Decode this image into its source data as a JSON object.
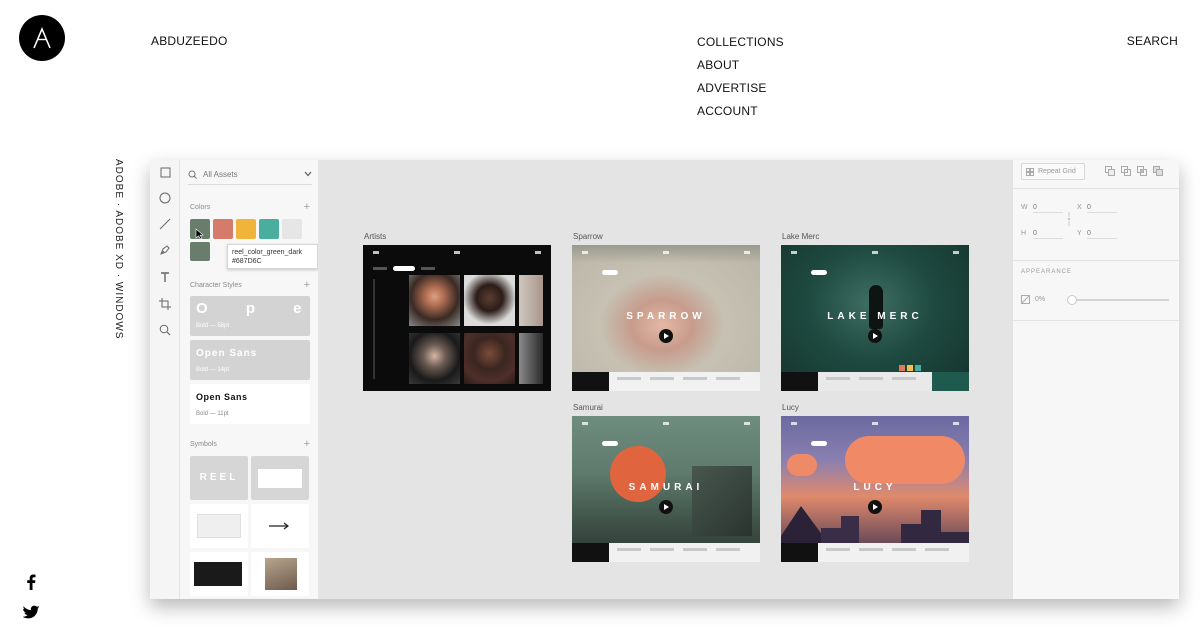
{
  "site": {
    "brand": "ABDUZEEDO",
    "nav": [
      "COLLECTIONS",
      "ABOUT",
      "ADVERTISE",
      "ACCOUNT"
    ],
    "search_label": "SEARCH",
    "vertical_label": "ADOBE · ADOBE XD · WINDOWS",
    "social": [
      "facebook-icon",
      "twitter-icon"
    ]
  },
  "xd": {
    "toolbar_tools": [
      "rectangle-tool-icon",
      "ellipse-tool-icon",
      "line-tool-icon",
      "pen-tool-icon",
      "text-tool-icon",
      "artboard-tool-icon",
      "zoom-tool-icon"
    ],
    "assets": {
      "search_placeholder": "All Assets",
      "colors_title": "Colors",
      "colors": [
        "#687D6C",
        "#D67A6C",
        "#F0B43A",
        "#4AAE9F",
        "#E6E6E6"
      ],
      "tooltip_name": "reel_color_green_dark",
      "tooltip_hex": "#687D6C",
      "char_styles_title": "Character Styles",
      "char_styles": [
        {
          "sample": "O p e ...",
          "meta": "Bold — 58pt"
        },
        {
          "sample": "Open Sans",
          "meta": "Bold — 14pt"
        },
        {
          "sample": "Open Sans",
          "meta": "Bold — 11pt"
        }
      ],
      "symbols_title": "Symbols",
      "symbol_reel_label": "REEL"
    },
    "artboards": [
      {
        "label": "Artists",
        "title": ""
      },
      {
        "label": "Sparrow",
        "title": "SPARROW"
      },
      {
        "label": "Lake Merc",
        "title": "LAKE MERC"
      },
      {
        "label": "Samurai",
        "title": "SAMURAI"
      },
      {
        "label": "Lucy",
        "title": "LUCY"
      }
    ],
    "properties": {
      "repeat_grid_label": "Repeat Grid",
      "w_label": "W",
      "w_value": "0",
      "h_label": "H",
      "h_value": "0",
      "x_label": "X",
      "x_value": "0",
      "y_label": "Y",
      "y_value": "0",
      "appearance_title": "APPEARANCE",
      "opacity_value": "0%",
      "opacity_level": 0
    }
  }
}
